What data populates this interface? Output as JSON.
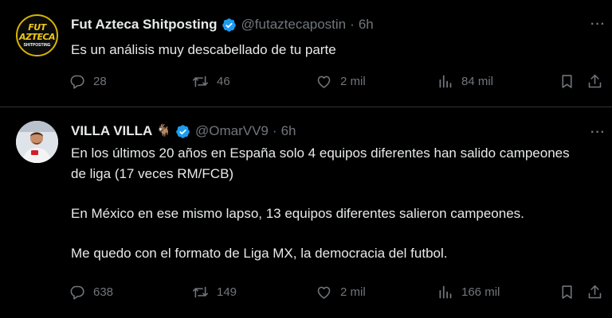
{
  "tweets": [
    {
      "display_name": "Fut Azteca Shitposting",
      "handle": "@futaztecapostin",
      "separator": "·",
      "time": "6h",
      "avatar_logo": {
        "line1": "FUT",
        "line2": "AZTECA",
        "line3": "SHITPOSTING"
      },
      "body": [
        "Es un análisis muy descabellado de tu parte"
      ],
      "actions": {
        "replies": "28",
        "reposts": "46",
        "likes": "2 mil",
        "views": "84 mil"
      }
    },
    {
      "display_name": "VILLA VILLA",
      "name_emoji": "🐐",
      "handle": "@OmarVV9",
      "separator": "·",
      "time": "6h",
      "body": [
        "En los últimos 20 años en España solo 4 equipos diferentes han salido campeones de liga (17 veces RM/FCB)",
        "En México en ese mismo lapso, 13 equipos diferentes salieron campeones.",
        "Me quedo con el formato de Liga MX, la democracia del futbol."
      ],
      "actions": {
        "replies": "638",
        "reposts": "149",
        "likes": "2 mil",
        "views": "166 mil"
      }
    }
  ],
  "more_label": "···",
  "colors": {
    "background": "#000000",
    "text": "#e7e9ea",
    "muted": "#71767b",
    "verified": "#1d9bf0",
    "divider": "#2f3336"
  },
  "icons": [
    "verified-badge-icon",
    "reply-icon",
    "repost-icon",
    "like-icon",
    "views-icon",
    "bookmark-icon",
    "share-icon",
    "more-icon"
  ]
}
